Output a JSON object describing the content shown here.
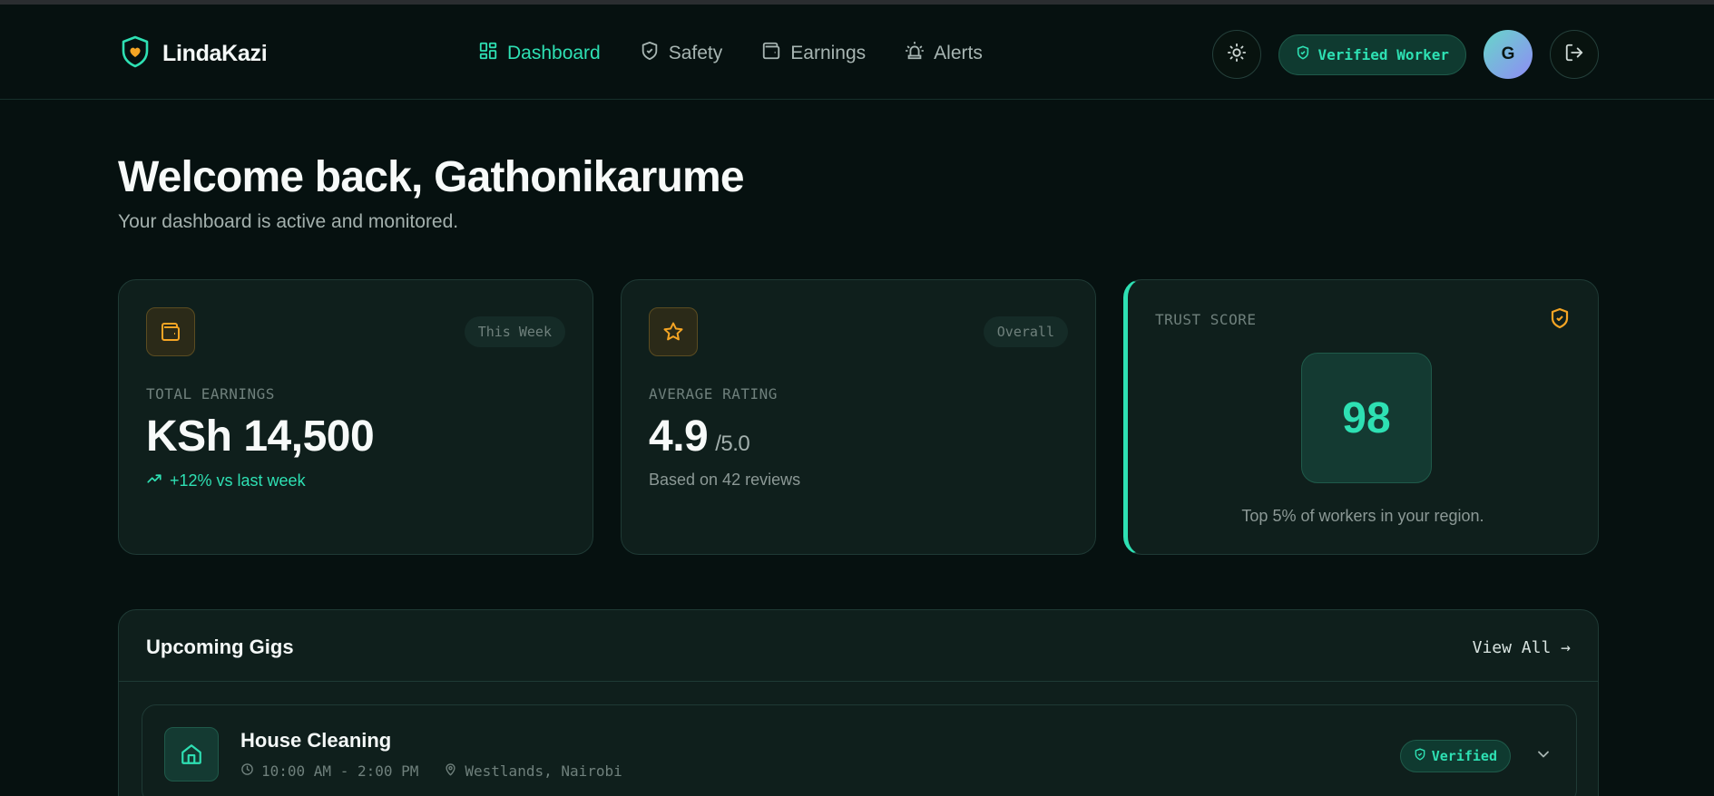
{
  "app": {
    "name": "LindaKazi"
  },
  "nav": {
    "items": [
      {
        "label": "Dashboard",
        "icon": "dashboard-icon",
        "active": true
      },
      {
        "label": "Safety",
        "icon": "shield-icon",
        "active": false
      },
      {
        "label": "Earnings",
        "icon": "wallet-icon",
        "active": false
      },
      {
        "label": "Alerts",
        "icon": "siren-icon",
        "active": false
      }
    ]
  },
  "header": {
    "verified_label": "Verified Worker",
    "avatar_initial": "G"
  },
  "welcome": {
    "title": "Welcome back, Gathonikarume",
    "subtitle": "Your dashboard is active and monitored."
  },
  "cards": {
    "earnings": {
      "badge": "This Week",
      "label": "TOTAL EARNINGS",
      "value": "KSh 14,500",
      "trend": "+12% vs last week"
    },
    "rating": {
      "badge": "Overall",
      "label": "AVERAGE RATING",
      "value": "4.9",
      "suffix": "/5.0",
      "note": "Based on 42 reviews"
    },
    "trust": {
      "label": "TRUST SCORE",
      "score": "98",
      "note": "Top 5% of workers in your region."
    }
  },
  "gigs": {
    "title": "Upcoming Gigs",
    "view_all": "View All →",
    "items": [
      {
        "title": "House Cleaning",
        "time": "10:00 AM - 2:00 PM",
        "location": "Westlands, Nairobi",
        "badge": "Verified"
      }
    ]
  },
  "colors": {
    "accent": "#2ee0b3",
    "background": "#061110",
    "card": "#0f1f1c",
    "amber": "#f5a524"
  }
}
